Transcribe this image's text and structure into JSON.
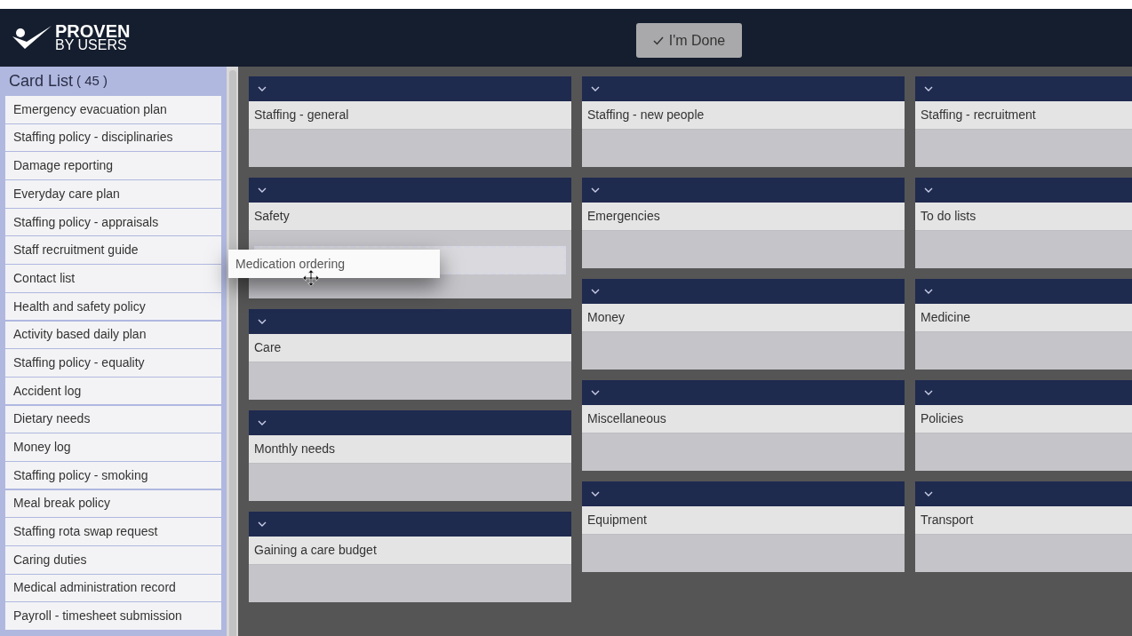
{
  "header": {
    "logo": {
      "line1": "PROVEN",
      "line2": "BY USERS"
    },
    "done_button": "I'm Done"
  },
  "card_list": {
    "title": "Card List",
    "count": "( 45 )",
    "items": [
      "Emergency evacuation plan",
      "Staffing policy - disciplinaries",
      "Damage reporting",
      "Everyday care plan",
      "Staffing policy - appraisals",
      "Staff recruitment guide",
      "Contact list",
      "Health and safety policy",
      "Activity based daily plan",
      "Staffing policy - equality",
      "Accident log",
      "Dietary needs",
      "Money log",
      "Staffing policy - smoking",
      "Meal break policy",
      "Staffing rota swap request",
      "Caring duties",
      "Medical administration record",
      "Payroll - timesheet submission"
    ]
  },
  "columns": [
    [
      {
        "title": "Staffing - general",
        "drop_placeholder": false
      },
      {
        "title": "Safety",
        "drop_placeholder": true
      },
      {
        "title": "Care",
        "drop_placeholder": false
      },
      {
        "title": "Monthly needs",
        "drop_placeholder": false
      },
      {
        "title": "Gaining a care budget",
        "drop_placeholder": false
      }
    ],
    [
      {
        "title": "Staffing - new people",
        "drop_placeholder": false
      },
      {
        "title": "Emergencies",
        "drop_placeholder": false
      },
      {
        "title": "Money",
        "drop_placeholder": false
      },
      {
        "title": "Miscellaneous",
        "drop_placeholder": false
      },
      {
        "title": "Equipment",
        "drop_placeholder": false
      }
    ],
    [
      {
        "title": "Staffing - recruitment",
        "drop_placeholder": false
      },
      {
        "title": "To do lists",
        "drop_placeholder": false
      },
      {
        "title": "Medicine",
        "drop_placeholder": false
      },
      {
        "title": "Policies",
        "drop_placeholder": false
      },
      {
        "title": "Transport",
        "drop_placeholder": false
      }
    ]
  ],
  "dragged_card": "Medication ordering"
}
